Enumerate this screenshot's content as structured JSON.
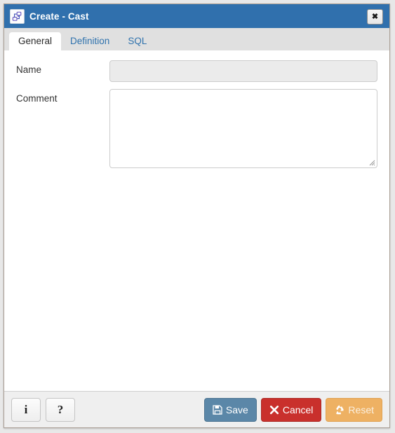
{
  "window": {
    "title": "Create - Cast",
    "icon": "cast-object-icon",
    "close_label": "✖",
    "close_icon": "close-icon",
    "titlebar_color": "#3070ad"
  },
  "tabs": [
    {
      "label": "General",
      "active": true
    },
    {
      "label": "Definition",
      "active": false
    },
    {
      "label": "SQL",
      "active": false
    }
  ],
  "form": {
    "fields": [
      {
        "label": "Name",
        "value": "",
        "placeholder": "",
        "type": "text",
        "disabled": true
      },
      {
        "label": "Comment",
        "value": "",
        "placeholder": "",
        "type": "textarea",
        "disabled": false
      }
    ]
  },
  "footer": {
    "info_label": "i",
    "info_icon": "info-icon",
    "help_label": "?",
    "help_icon": "help-icon",
    "buttons": [
      {
        "label": "Save",
        "icon": "floppy-disk-icon",
        "color": "#5b87a8"
      },
      {
        "label": "Cancel",
        "icon": "cross-icon",
        "color": "#c9302c"
      },
      {
        "label": "Reset",
        "icon": "recycle-icon",
        "color": "#eeb163"
      }
    ]
  }
}
